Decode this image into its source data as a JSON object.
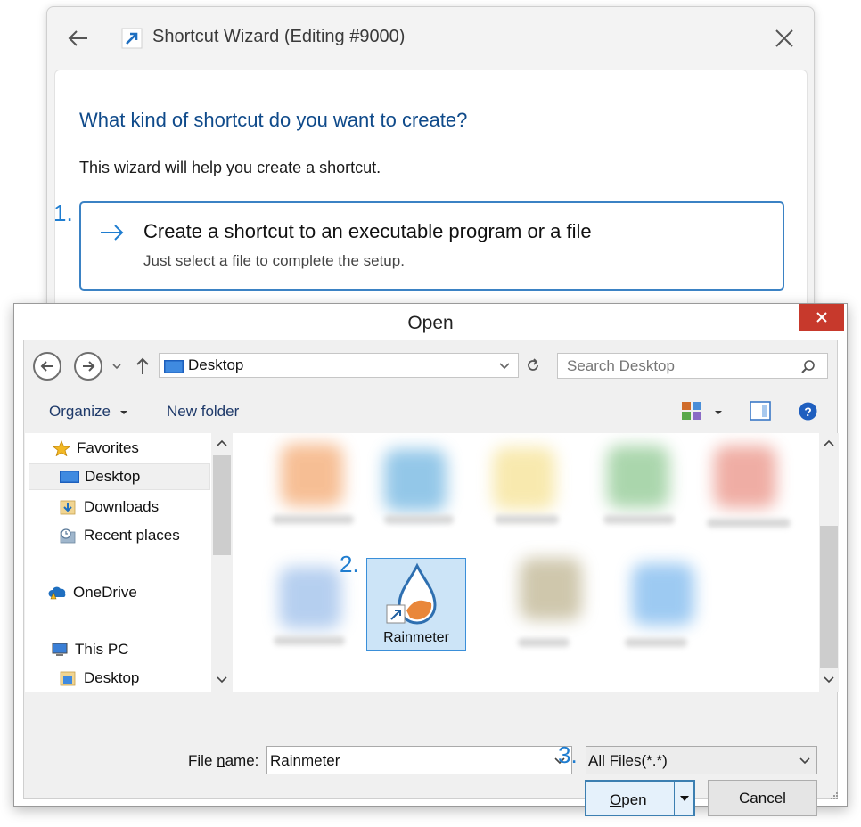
{
  "wizard": {
    "title": "Shortcut Wizard (Editing #9000)",
    "heading": "What kind of shortcut do you want to create?",
    "intro": "This wizard will help you create a shortcut.",
    "option": {
      "title": "Create a shortcut to an executable program or a file",
      "description": "Just select a file to complete the setup."
    }
  },
  "steps": [
    "1.",
    "2.",
    "3."
  ],
  "dialog": {
    "title": "Open",
    "address": "Desktop",
    "search_placeholder": "Search Desktop",
    "toolbar": {
      "organize": "Organize",
      "new_folder": "New folder"
    },
    "nav": {
      "favorites": "Favorites",
      "desktop": "Desktop",
      "downloads": "Downloads",
      "recent_places": "Recent places",
      "onedrive": "OneDrive",
      "this_pc": "This PC",
      "pc_desktop": "Desktop"
    },
    "selected_file": "Rainmeter",
    "file_name_label_prefix": "File ",
    "file_name_label_ul": "n",
    "file_name_label_suffix": "ame:",
    "file_name_value": "Rainmeter",
    "file_type": "All Files(*.*)",
    "open_ul": "O",
    "open_rest": "pen",
    "cancel": "Cancel"
  },
  "colors": {
    "accent": "#1f7dd0",
    "heading": "#0f4a8a",
    "close_red": "#c7392c",
    "selection": "#cce4f7"
  }
}
